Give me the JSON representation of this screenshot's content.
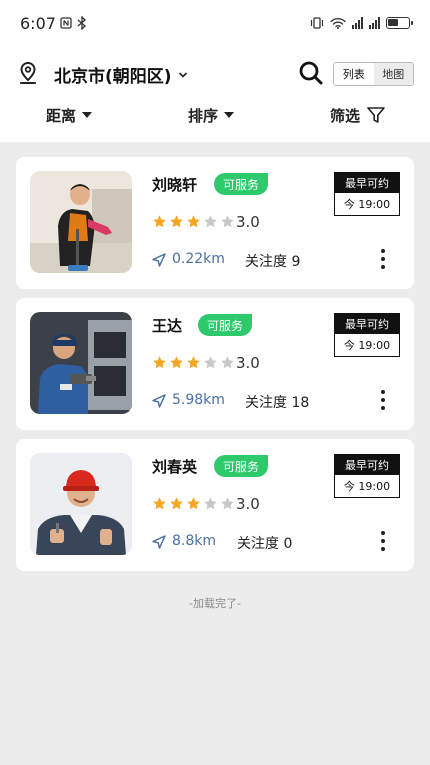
{
  "status_bar": {
    "time": "6:07",
    "extra_icons": [
      "nfc-icon",
      "bluetooth-icon"
    ]
  },
  "location": {
    "city": "北京市(朝阳区)"
  },
  "view_toggle": {
    "list_label": "列表",
    "map_label": "地图",
    "active": "list"
  },
  "filters": {
    "distance": "距离",
    "sort": "排序",
    "filter": "筛选"
  },
  "workers": [
    {
      "name": "刘晓轩",
      "status": "可服务",
      "rating": 3.0,
      "rating_text": "3.0",
      "distance": "0.22km",
      "follow": "关注度 9",
      "slot_label": "最早可约",
      "slot_time": "今 19:00"
    },
    {
      "name": "王达",
      "status": "可服务",
      "rating": 3.0,
      "rating_text": "3.0",
      "distance": "5.98km",
      "follow": "关注度 18",
      "slot_label": "最早可约",
      "slot_time": "今 19:00"
    },
    {
      "name": "刘春英",
      "status": "可服务",
      "rating": 3.0,
      "rating_text": "3.0",
      "distance": "8.8km",
      "follow": "关注度 0",
      "slot_label": "最早可约",
      "slot_time": "今 19:00"
    }
  ],
  "footer_text": "-加载完了-",
  "colors": {
    "accent_green": "#2dc96b",
    "star_gold": "#f5a623",
    "star_gray": "#c8c8c8",
    "distance_blue": "#4a6fa5"
  }
}
